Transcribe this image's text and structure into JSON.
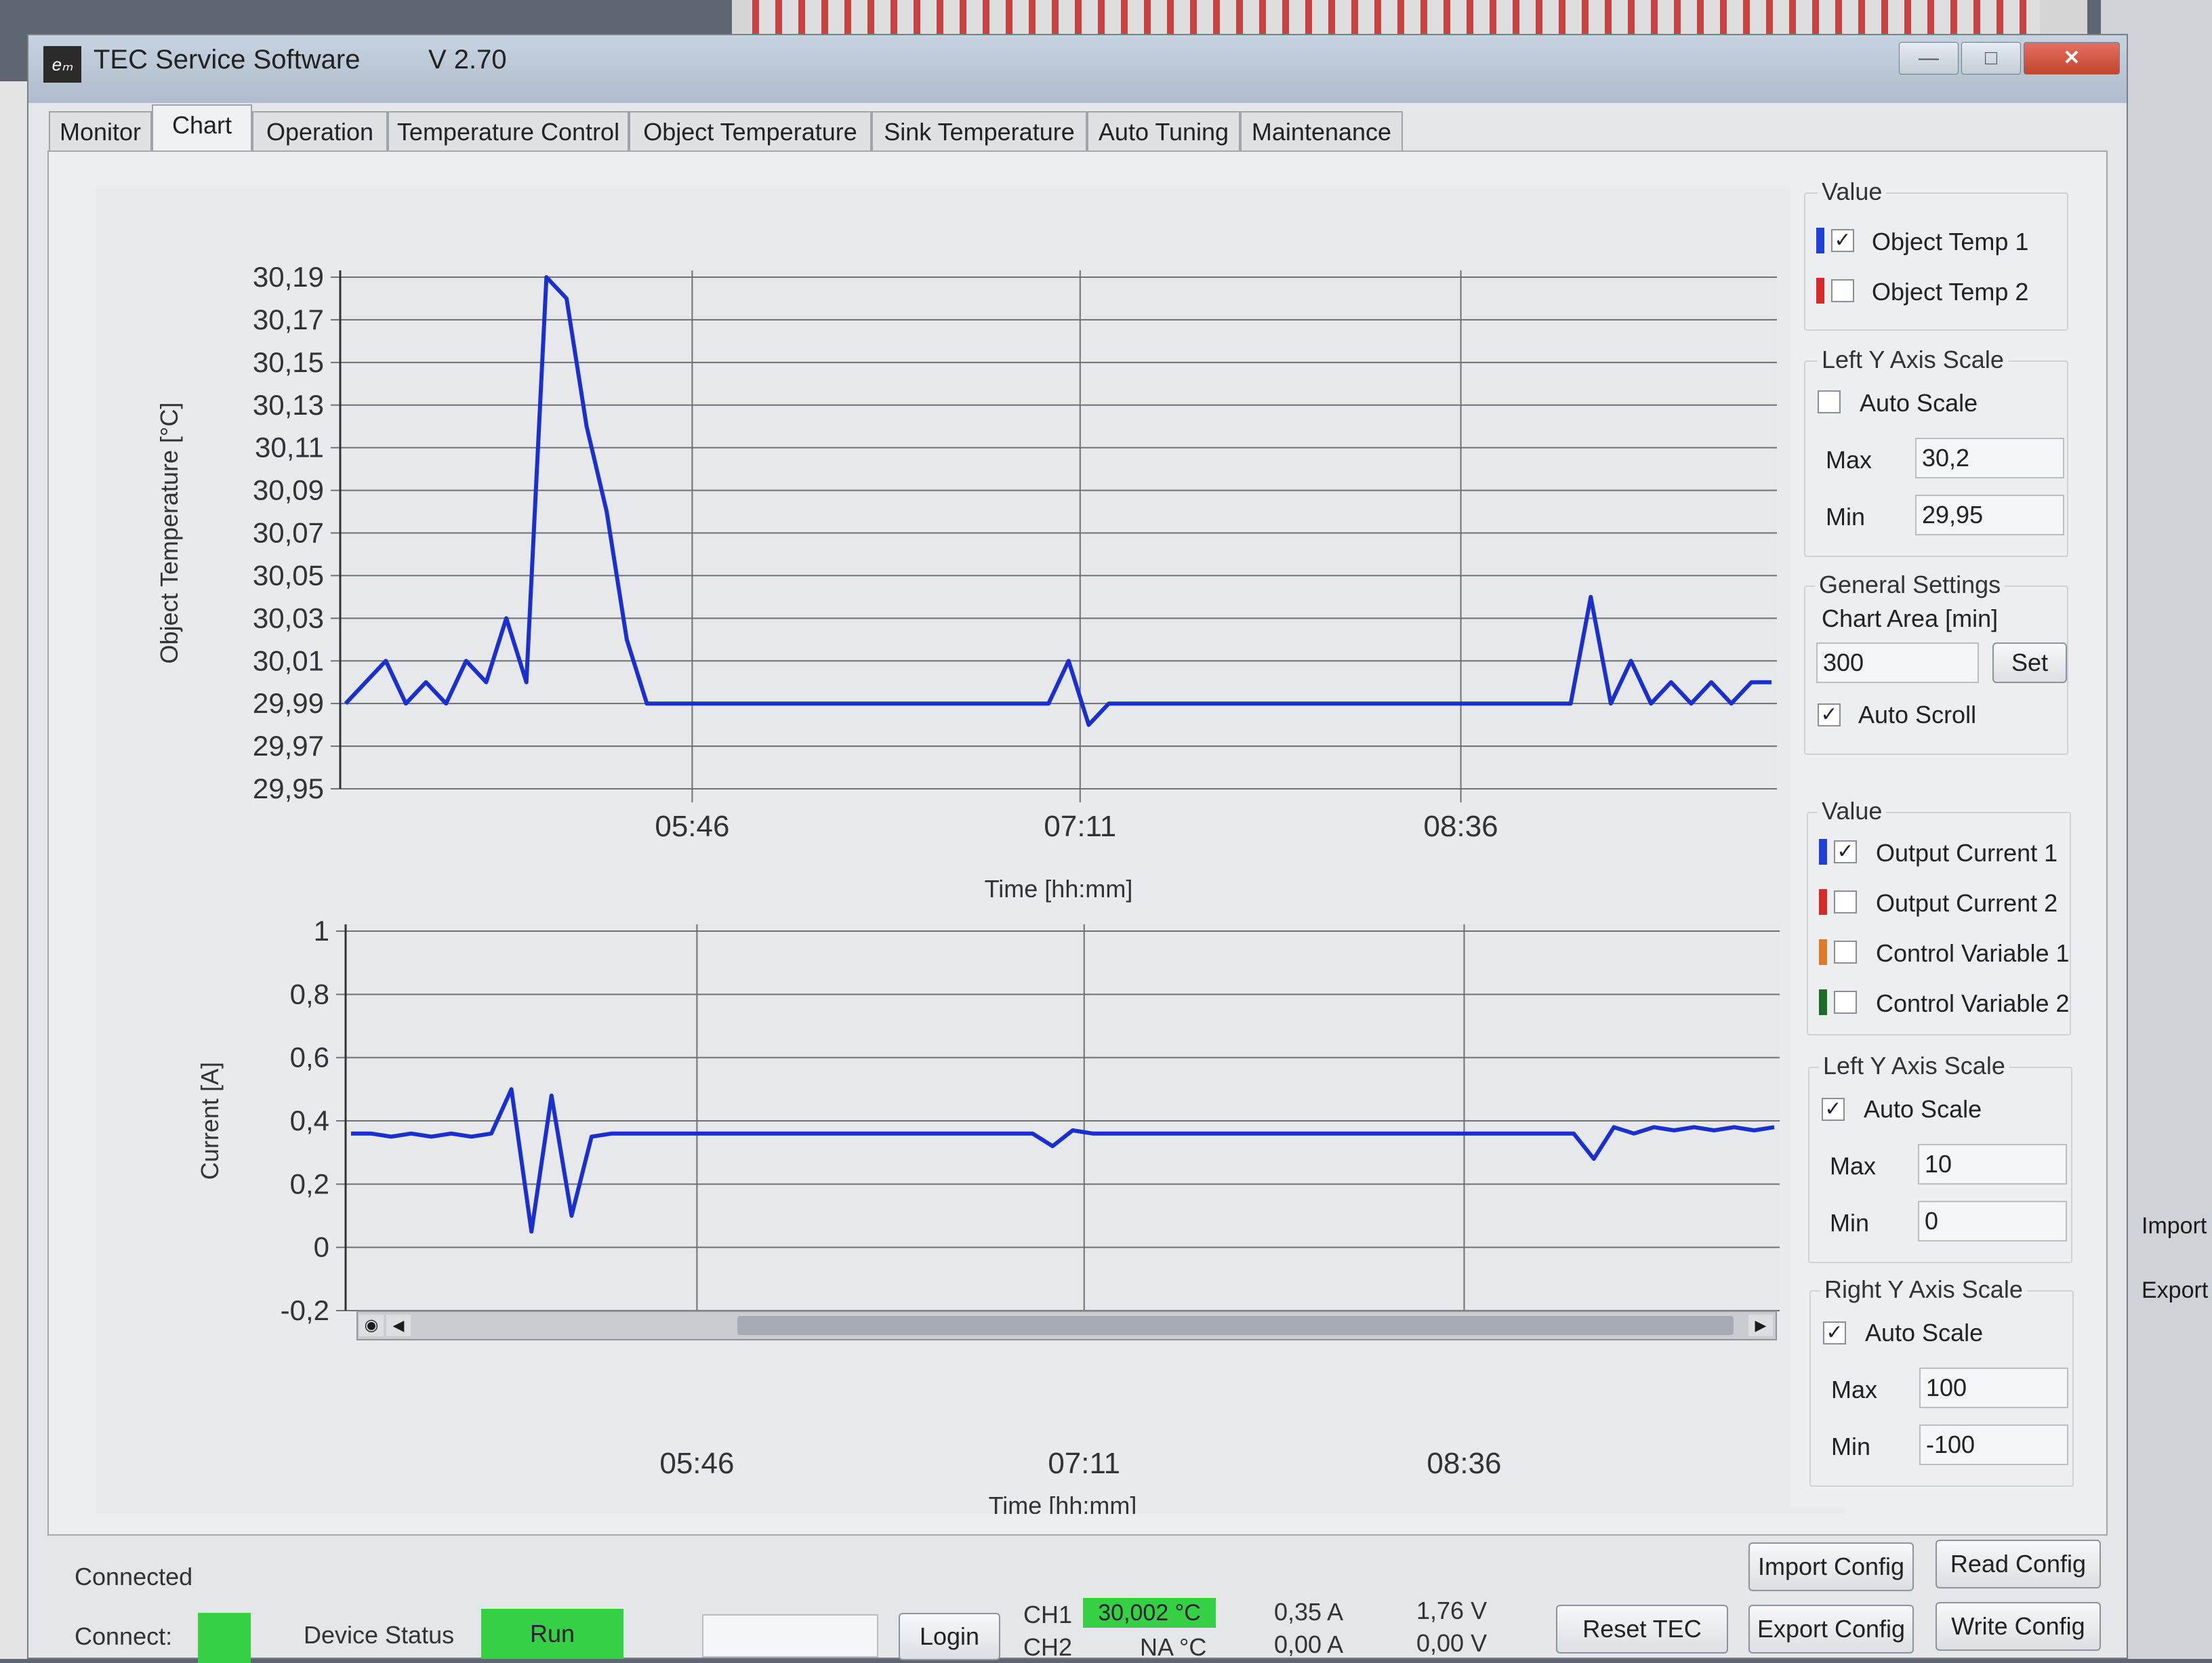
{
  "window": {
    "title": "TEC Service Software",
    "version": "V 2.70",
    "icon_text": "eₘ"
  },
  "tabs": [
    "Monitor",
    "Chart",
    "Operation",
    "Temperature Control",
    "Object Temperature",
    "Sink Temperature",
    "Auto Tuning",
    "Maintenance"
  ],
  "active_tab": "Chart",
  "chart_data": [
    {
      "type": "line",
      "ylabel": "Object Temperature [°C]",
      "xlabel": "Time [hh:mm]",
      "ylim": [
        29.95,
        30.2
      ],
      "yticks": [
        "30,19",
        "30,17",
        "30,15",
        "30,13",
        "30,11",
        "30,09",
        "30,07",
        "30,05",
        "30,03",
        "30,01",
        "29,99",
        "29,97",
        "29,95"
      ],
      "xticks": [
        "05:46",
        "07:11",
        "08:36"
      ],
      "series": [
        {
          "values": [
            29.99,
            30.0,
            30.01,
            29.99,
            30.0,
            29.99,
            30.01,
            30.0,
            30.03,
            30.0,
            30.19,
            30.18,
            30.12,
            30.08,
            30.02,
            29.99,
            29.99,
            29.99,
            29.99,
            29.99,
            29.99,
            29.99,
            29.99,
            29.99,
            29.99,
            29.99,
            29.99,
            29.99,
            29.99,
            29.99,
            29.99,
            29.99,
            29.99,
            29.99,
            29.99,
            29.99,
            30.01,
            29.98,
            29.99,
            29.99,
            29.99,
            29.99,
            29.99,
            29.99,
            29.99,
            29.99,
            29.99,
            29.99,
            29.99,
            29.99,
            29.99,
            29.99,
            29.99,
            29.99,
            29.99,
            29.99,
            29.99,
            29.99,
            29.99,
            29.99,
            29.99,
            29.99,
            30.04,
            29.99,
            30.01,
            29.99,
            30.0,
            29.99,
            30.0,
            29.99,
            30.0,
            30.0
          ]
        }
      ]
    },
    {
      "type": "line",
      "ylabel": "Current [A]",
      "xlabel": "Time [hh:mm]",
      "ylim": [
        -0.2,
        1
      ],
      "yticks": [
        "1",
        "0,8",
        "0,6",
        "0,4",
        "0,2",
        "0",
        "-0,2"
      ],
      "xticks": [
        "05:46",
        "07:11",
        "08:36"
      ],
      "series": [
        {
          "values": [
            0.36,
            0.36,
            0.35,
            0.36,
            0.35,
            0.36,
            0.35,
            0.36,
            0.5,
            0.05,
            0.48,
            0.1,
            0.35,
            0.36,
            0.36,
            0.36,
            0.36,
            0.36,
            0.36,
            0.36,
            0.36,
            0.36,
            0.36,
            0.36,
            0.36,
            0.36,
            0.36,
            0.36,
            0.36,
            0.36,
            0.36,
            0.36,
            0.36,
            0.36,
            0.36,
            0.32,
            0.37,
            0.36,
            0.36,
            0.36,
            0.36,
            0.36,
            0.36,
            0.36,
            0.36,
            0.36,
            0.36,
            0.36,
            0.36,
            0.36,
            0.36,
            0.36,
            0.36,
            0.36,
            0.36,
            0.36,
            0.36,
            0.36,
            0.36,
            0.36,
            0.36,
            0.36,
            0.28,
            0.38,
            0.36,
            0.38,
            0.37,
            0.38,
            0.37,
            0.38,
            0.37,
            0.38
          ]
        }
      ]
    }
  ],
  "right_panel": {
    "value1": {
      "title": "Value",
      "items": [
        {
          "label": "Object Temp 1",
          "checked": true,
          "color": "#1f3fd6"
        },
        {
          "label": "Object Temp 2",
          "checked": false,
          "color": "#d62a2a"
        }
      ]
    },
    "left_y1": {
      "title": "Left Y Axis Scale",
      "auto_label": "Auto Scale",
      "auto": false,
      "max_label": "Max",
      "max": "30,2",
      "min_label": "Min",
      "min": "29,95"
    },
    "general": {
      "title": "General Settings",
      "chart_area_label": "Chart Area [min]",
      "chart_area": "300",
      "set_label": "Set",
      "auto_scroll_label": "Auto Scroll",
      "auto_scroll": true
    },
    "value2": {
      "title": "Value",
      "items": [
        {
          "label": "Output Current 1",
          "checked": true,
          "color": "#1f3fd6"
        },
        {
          "label": "Output Current 2",
          "checked": false,
          "color": "#d62a2a"
        },
        {
          "label": "Control Variable 1",
          "checked": false,
          "color": "#e0792a"
        },
        {
          "label": "Control Variable 2",
          "checked": false,
          "color": "#1e6b2c"
        }
      ]
    },
    "left_y2": {
      "title": "Left Y Axis Scale",
      "auto_label": "Auto Scale",
      "auto": true,
      "max_label": "Max",
      "max": "10",
      "min_label": "Min",
      "min": "0"
    },
    "right_y2": {
      "title": "Right Y Axis Scale",
      "auto_label": "Auto Scale",
      "auto": true,
      "max_label": "Max",
      "max": "100",
      "min_label": "Min",
      "min": "-100"
    }
  },
  "bottom": {
    "connected_label": "Connected",
    "connect_label": "Connect:",
    "device_status_label": "Device Status",
    "run_label": "Run",
    "login_label": "Login",
    "ch1_label": "CH1",
    "ch1_temp": "30,002 °C",
    "ch2_label": "CH2",
    "ch2_temp": "NA °C",
    "ch1_current": "0,35 A",
    "ch2_current": "0,00 A",
    "ch1_voltage": "1,76 V",
    "ch2_voltage": "0,00 V",
    "reset_tec": "Reset TEC",
    "import_config": "Import Config",
    "export_config": "Export Config",
    "read_config": "Read Config",
    "write_config": "Write Config"
  },
  "background": {
    "import_label": "Import",
    "export_label": "Export"
  }
}
